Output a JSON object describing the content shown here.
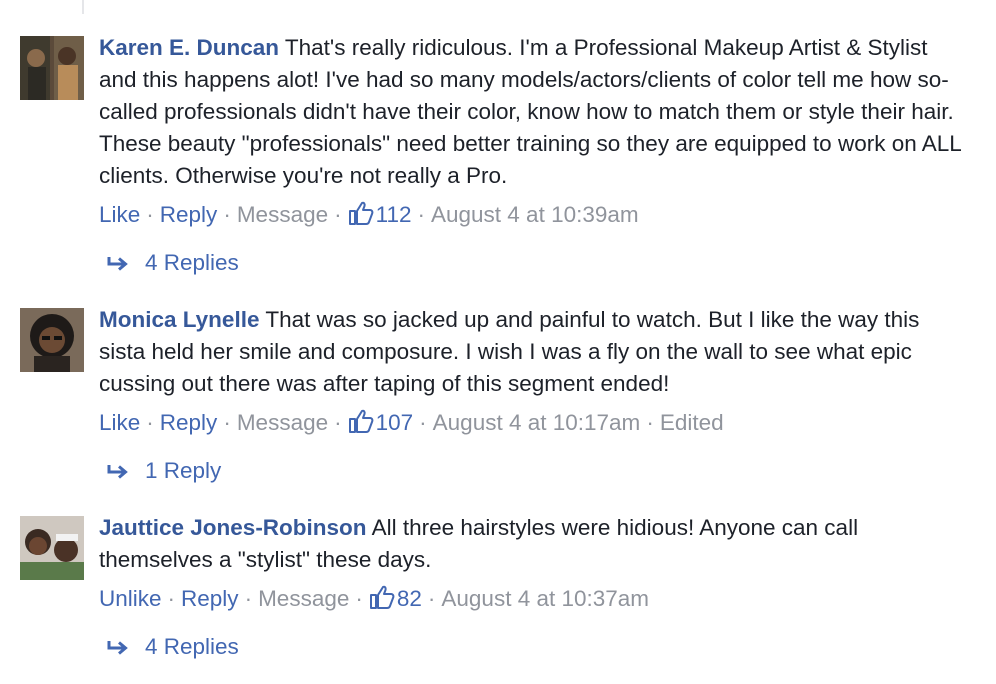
{
  "comments": [
    {
      "author": "Karen E. Duncan",
      "text": "That's really ridiculous. I'm a Professional Makeup Artist & Stylist and this happens alot! I've had so many models/actors/clients of color tell me how so-called professionals didn't have their color, know how to match them or style their hair. These beauty \"professionals\" need better training so they are equipped to work on ALL clients. Otherwise you're not really a Pro.",
      "like_label": "Like",
      "reply_label": "Reply",
      "message_label": "Message",
      "likes": "112",
      "timestamp": "August 4 at 10:39am",
      "edited": "",
      "replies_label": "4 Replies"
    },
    {
      "author": "Monica Lynelle",
      "text": "That was so jacked up and painful to watch. But I like the way this sista held her smile and composure. I wish I was a fly on the wall to see what epic cussing out there was after taping of this segment ended!",
      "like_label": "Like",
      "reply_label": "Reply",
      "message_label": "Message",
      "likes": "107",
      "timestamp": "August 4 at 10:17am",
      "edited": "Edited",
      "replies_label": "1 Reply"
    },
    {
      "author": "Jauttice Jones-Robinson",
      "text": "All three hairstyles were hidious! Anyone can call themselves a \"stylist\" these days.",
      "like_label": "Unlike",
      "reply_label": "Reply",
      "message_label": "Message",
      "likes": "82",
      "timestamp": "August 4 at 10:37am",
      "edited": "",
      "replies_label": "4 Replies"
    }
  ],
  "separator": "·",
  "colors": {
    "link": "#4267b2",
    "author": "#365899",
    "muted": "#90949c",
    "text": "#1d2129"
  },
  "icons": {
    "like": "thumbs-up-icon",
    "reply_arrow": "reply-arrow-icon"
  }
}
